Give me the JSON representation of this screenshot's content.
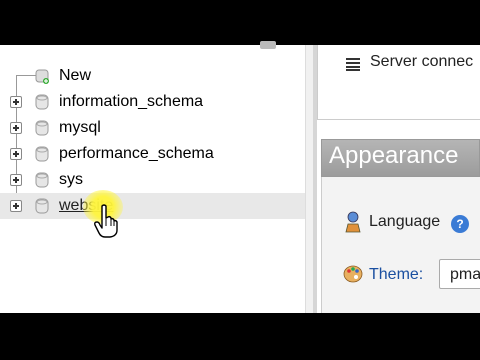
{
  "navigation": {
    "tree": [
      {
        "label": "New",
        "kind": "new"
      },
      {
        "label": "information_schema",
        "kind": "database"
      },
      {
        "label": "mysql",
        "kind": "database"
      },
      {
        "label": "performance_schema",
        "kind": "database"
      },
      {
        "label": "sys",
        "kind": "database"
      },
      {
        "label": "website",
        "kind": "database",
        "hovered": true
      }
    ]
  },
  "main": {
    "server_connection_label": "Server connec",
    "appearance": {
      "title": "Appearance",
      "language_label": "Language",
      "theme_label": "Theme:",
      "theme_value": "pma"
    }
  },
  "icons": {
    "server": "server-list-icon",
    "language": "language-icon",
    "help": "help-icon",
    "theme": "palette-icon",
    "cursor": "hand-pointer-icon"
  },
  "colors": {
    "appearance_header": "#a8a8a8",
    "help_icon": "#3a7bd5",
    "theme_label": "#1a4fa0",
    "cursor_highlight": "#fff53c"
  }
}
